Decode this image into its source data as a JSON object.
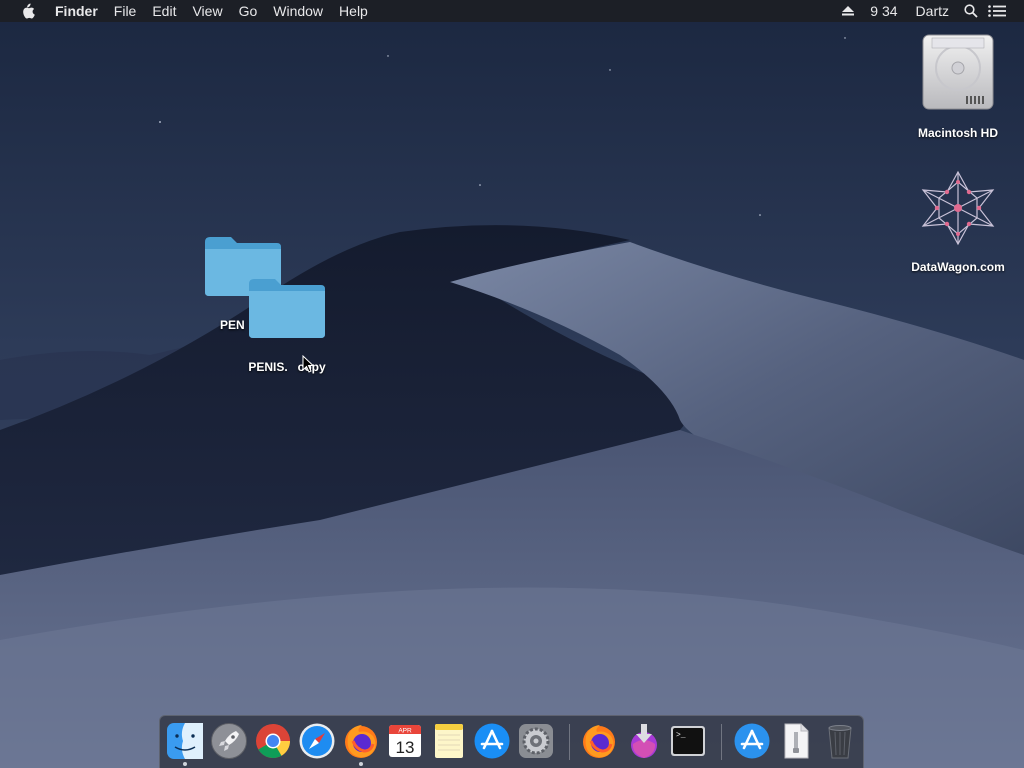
{
  "menubar": {
    "app_name": "Finder",
    "menus": [
      "File",
      "Edit",
      "View",
      "Go",
      "Window",
      "Help"
    ],
    "clock": "9 34",
    "user": "Dartz"
  },
  "desktop": {
    "icons": [
      {
        "label": "Macintosh HD",
        "icon": "hard-drive-icon"
      },
      {
        "label": "DataWagon.com",
        "icon": "network-star-icon"
      },
      {
        "label": "PEN",
        "icon": "folder-icon"
      },
      {
        "label": "PENIS.   copy",
        "icon": "folder-icon"
      }
    ]
  },
  "dock": {
    "apps": [
      {
        "name": "Finder",
        "icon": "finder-icon",
        "running": true
      },
      {
        "name": "Launchpad",
        "icon": "launchpad-icon",
        "running": false
      },
      {
        "name": "Google Chrome",
        "icon": "chrome-icon",
        "running": false
      },
      {
        "name": "Safari",
        "icon": "safari-icon",
        "running": false
      },
      {
        "name": "Firefox",
        "icon": "firefox-icon",
        "running": true
      },
      {
        "name": "Calendar",
        "icon": "calendar-icon",
        "running": false,
        "month": "APR",
        "day": "13"
      },
      {
        "name": "Notes",
        "icon": "notes-icon",
        "running": false
      },
      {
        "name": "App Store",
        "icon": "app-store-icon",
        "running": false
      },
      {
        "name": "System Preferences",
        "icon": "system-preferences-icon",
        "running": false
      },
      {
        "name": "Firefox",
        "icon": "firefox-icon",
        "running": false
      },
      {
        "name": "Downloader",
        "icon": "downloader-icon",
        "running": false
      },
      {
        "name": "Terminal",
        "icon": "terminal-icon",
        "running": false,
        "prompt": ">_"
      },
      {
        "name": "Applications",
        "icon": "app-store-icon",
        "running": false
      },
      {
        "name": "Documents",
        "icon": "document-icon",
        "running": false
      },
      {
        "name": "Trash",
        "icon": "trash-icon",
        "running": false
      }
    ]
  }
}
